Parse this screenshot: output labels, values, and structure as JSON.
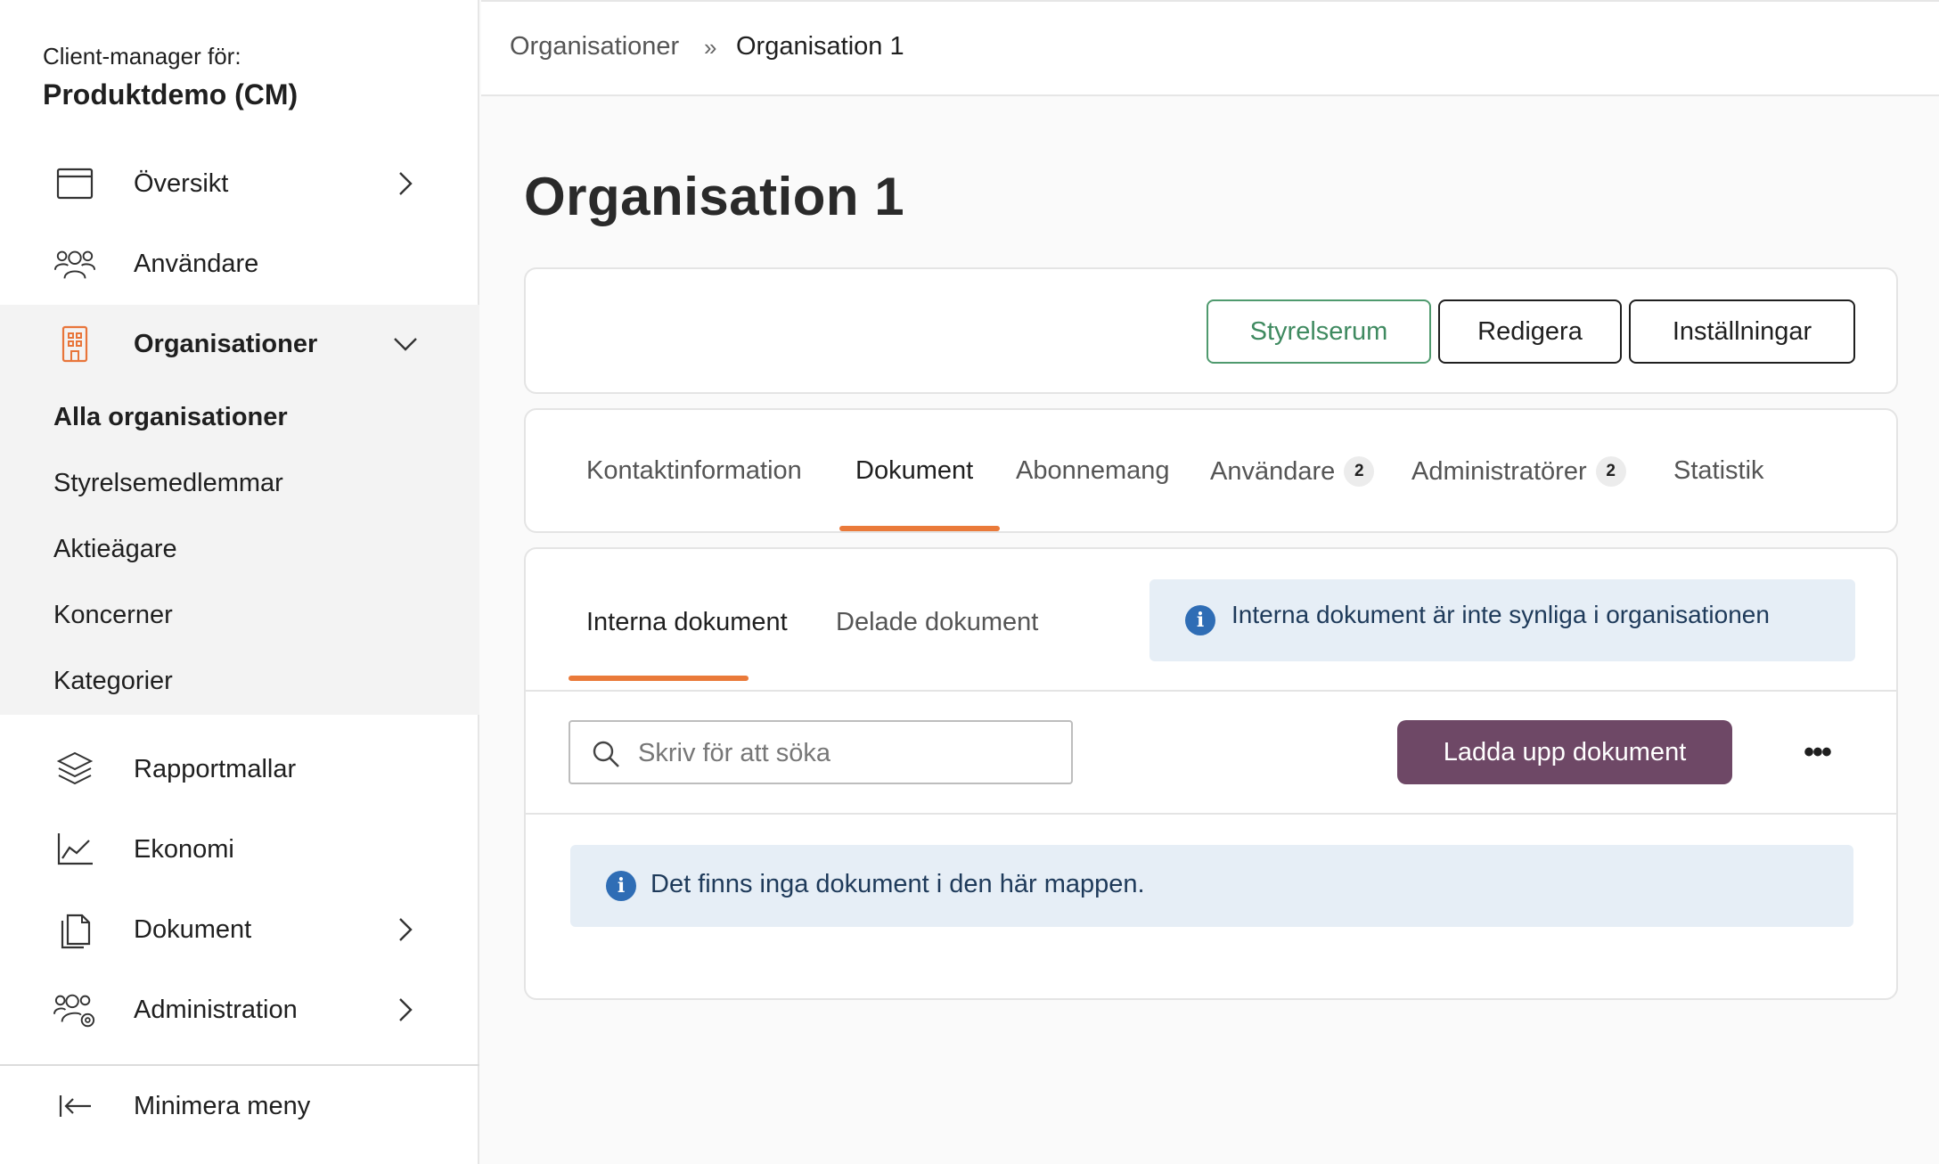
{
  "sidebar": {
    "client_label": "Client-manager för:",
    "client_name": "Produktdemo (CM)",
    "items": [
      {
        "label": "Översikt",
        "icon": "calendar-window-icon",
        "has_chevron": true
      },
      {
        "label": "Användare",
        "icon": "users-icon",
        "has_chevron": false
      },
      {
        "label": "Organisationer",
        "icon": "building-icon",
        "expanded": true
      },
      {
        "label": "Rapportmallar",
        "icon": "layers-icon",
        "has_chevron": false
      },
      {
        "label": "Ekonomi",
        "icon": "line-chart-icon",
        "has_chevron": false
      },
      {
        "label": "Dokument",
        "icon": "documents-icon",
        "has_chevron": true
      },
      {
        "label": "Administration",
        "icon": "users-gear-icon",
        "has_chevron": true
      }
    ],
    "sub_items": [
      {
        "label": "Alla organisationer",
        "active": true
      },
      {
        "label": "Styrelsemedlemmar"
      },
      {
        "label": "Aktieägare"
      },
      {
        "label": "Koncerner"
      },
      {
        "label": "Kategorier"
      }
    ],
    "minimize_label": "Minimera meny"
  },
  "breadcrumb": {
    "root": "Organisationer",
    "current": "Organisation 1"
  },
  "page_title": "Organisation 1",
  "actions": {
    "boardroom": "Styrelserum",
    "edit": "Redigera",
    "settings": "Inställningar"
  },
  "tabs": [
    {
      "label": "Kontaktinformation"
    },
    {
      "label": "Dokument",
      "active": true
    },
    {
      "label": "Abonnemang"
    },
    {
      "label": "Användare",
      "badge": "2"
    },
    {
      "label": "Administratörer",
      "badge": "2"
    },
    {
      "label": "Statistik"
    }
  ],
  "documents": {
    "subtabs": [
      {
        "label": "Interna dokument",
        "active": true
      },
      {
        "label": "Delade dokument"
      }
    ],
    "info_text": "Interna dokument är inte synliga i organisationen",
    "search_placeholder": "Skriv för att söka",
    "upload_label": "Ladda upp dokument",
    "more_label": "•••",
    "empty_text": "Det finns inga dokument i den här mappen."
  },
  "colors": {
    "accent_orange": "#ea7a3a",
    "upload_purple": "#6e4866",
    "boardroom_green": "#4f9a6e",
    "info_blue": "#2f6db5",
    "info_bg": "#e6eef6"
  }
}
